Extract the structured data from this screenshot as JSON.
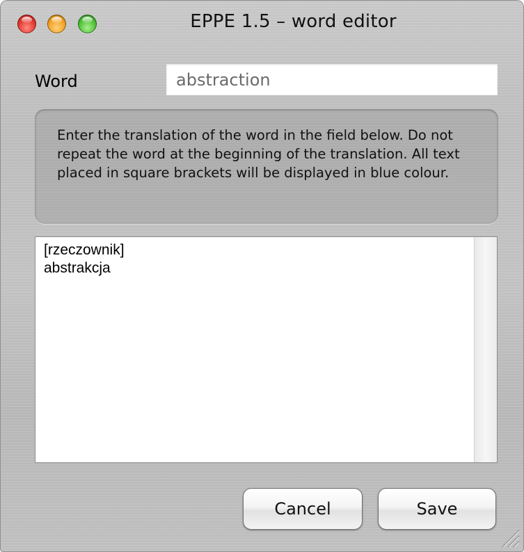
{
  "window": {
    "title": "EPPE 1.5 – word editor"
  },
  "traffic_lights": {
    "close": "close-button",
    "minimize": "minimize-button",
    "zoom": "zoom-button"
  },
  "form": {
    "word_label": "Word",
    "word_value": "abstraction",
    "info_text": "Enter the translation of the word in the field below. Do not repeat the word at the beginning of the translation. All text placed in square brackets will be displayed in blue colour.",
    "translation_value": "[rzeczownik]\nabstrakcja"
  },
  "buttons": {
    "cancel": "Cancel",
    "save": "Save"
  },
  "colors": {
    "close": "#e0362c",
    "minimize": "#f0a021",
    "zoom": "#4cbc35"
  }
}
